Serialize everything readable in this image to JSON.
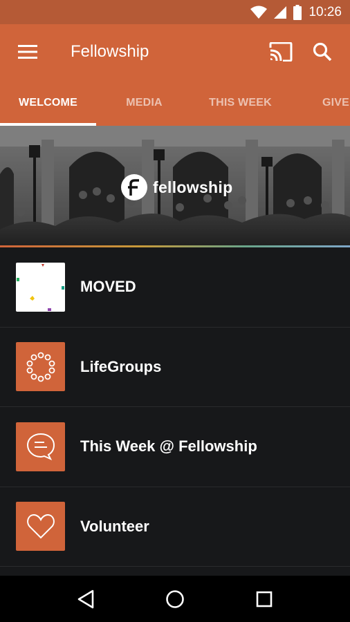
{
  "status_bar": {
    "time": "10:26"
  },
  "app_bar": {
    "title": "Fellowship"
  },
  "tabs": [
    {
      "label": "WELCOME",
      "active": true
    },
    {
      "label": "MEDIA",
      "active": false
    },
    {
      "label": "THIS WEEK",
      "active": false
    },
    {
      "label": "GIVE",
      "active": false
    }
  ],
  "hero": {
    "logo_text": "fellowship"
  },
  "list": [
    {
      "label": "MOVED",
      "icon": "moved-logo-icon"
    },
    {
      "label": "LifeGroups",
      "icon": "circle-of-dots-icon"
    },
    {
      "label": "This Week @ Fellowship",
      "icon": "chat-bubble-icon"
    },
    {
      "label": "Volunteer",
      "icon": "heart-icon"
    }
  ],
  "colors": {
    "brand": "#d0643a",
    "status_bar": "#b55a36",
    "background": "#17181a"
  }
}
